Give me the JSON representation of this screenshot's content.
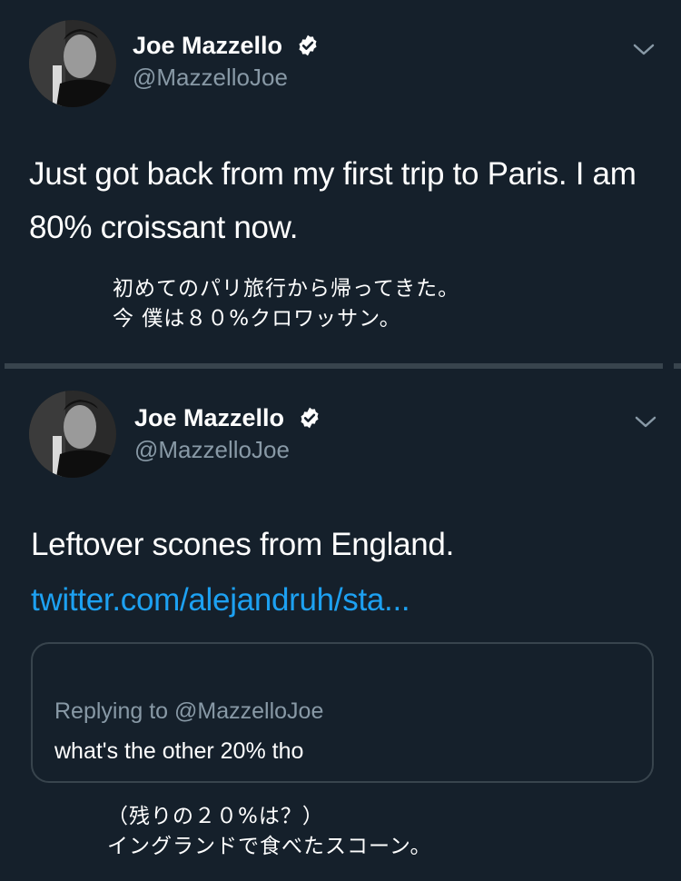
{
  "colors": {
    "background": "#15202b",
    "divider": "#38444d",
    "secondary_text": "#8899a6",
    "link": "#1da1f2"
  },
  "tweets": [
    {
      "author_name": "Joe Mazzello",
      "author_handle": "@MazzelloJoe",
      "verified_icon": "verified-badge-icon",
      "menu_icon": "chevron-down-icon",
      "text": "Just got back from my first trip to Paris. I am 80% croissant now.",
      "caption_lines": [
        "初めてのパリ旅行から帰ってきた。",
        "今 僕は８０%クロワッサン。"
      ]
    },
    {
      "author_name": "Joe Mazzello",
      "author_handle": "@MazzelloJoe",
      "verified_icon": "verified-badge-icon",
      "menu_icon": "chevron-down-icon",
      "text": "Leftover scones from England.",
      "link": "twitter.com/alejandruh/sta...",
      "quoted": {
        "replying_to": "Replying to @MazzelloJoe",
        "text": "what's the other 20% tho"
      },
      "caption_lines": [
        "（残りの２０%は？）",
        "イングランドで食べたスコーン。"
      ]
    }
  ]
}
